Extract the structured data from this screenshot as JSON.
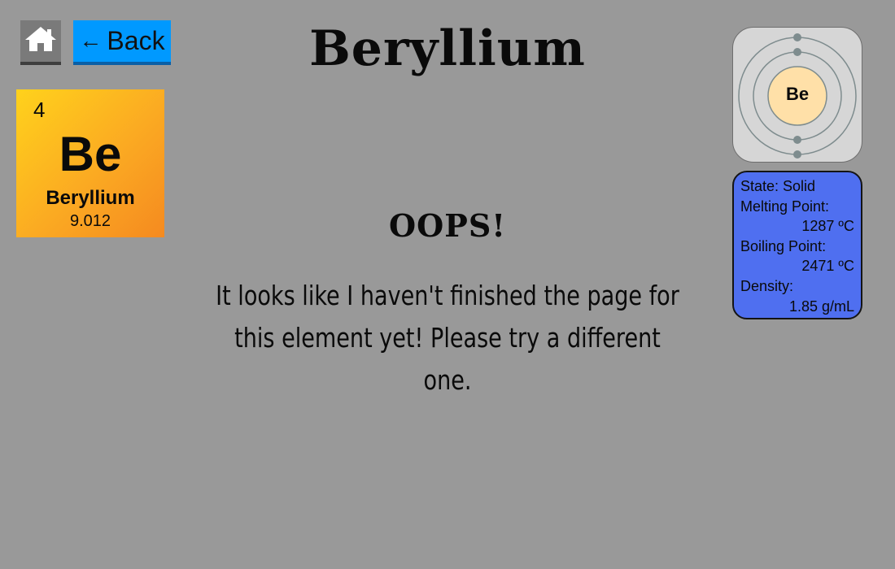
{
  "nav": {
    "back_arrow": "←",
    "back_label": "Back"
  },
  "page": {
    "title": "Beryllium"
  },
  "element": {
    "atomic_number": "4",
    "symbol": "Be",
    "name": "Beryllium",
    "atomic_mass": "9.012",
    "tile_color": "#fbaa22"
  },
  "bohr_model": {
    "nucleus_label": "Be",
    "electron_shells": [
      2,
      2
    ],
    "nucleus_color": "#ffe0a8",
    "electron_color": "#7e8c8e"
  },
  "properties": {
    "state": "State: Solid",
    "melting_point_label": "Melting Point:",
    "melting_point_value": "1287 ºC",
    "boiling_point_label": "Boiling Point:",
    "boiling_point_value": "2471 ºC",
    "density_label": "Density:",
    "density_value": "1.85 g/mL",
    "card_color": "#4f6ff0"
  },
  "message": {
    "title": "OOPS!",
    "line1": "It looks like I haven't finished the page for",
    "line2": "this element yet! Please try a different one."
  },
  "icons": {
    "home": "home-icon",
    "back_arrow": "arrow-left-icon"
  },
  "colors": {
    "background": "#999999",
    "back_button": "#0099ff",
    "home_button": "#7a7a7a"
  }
}
